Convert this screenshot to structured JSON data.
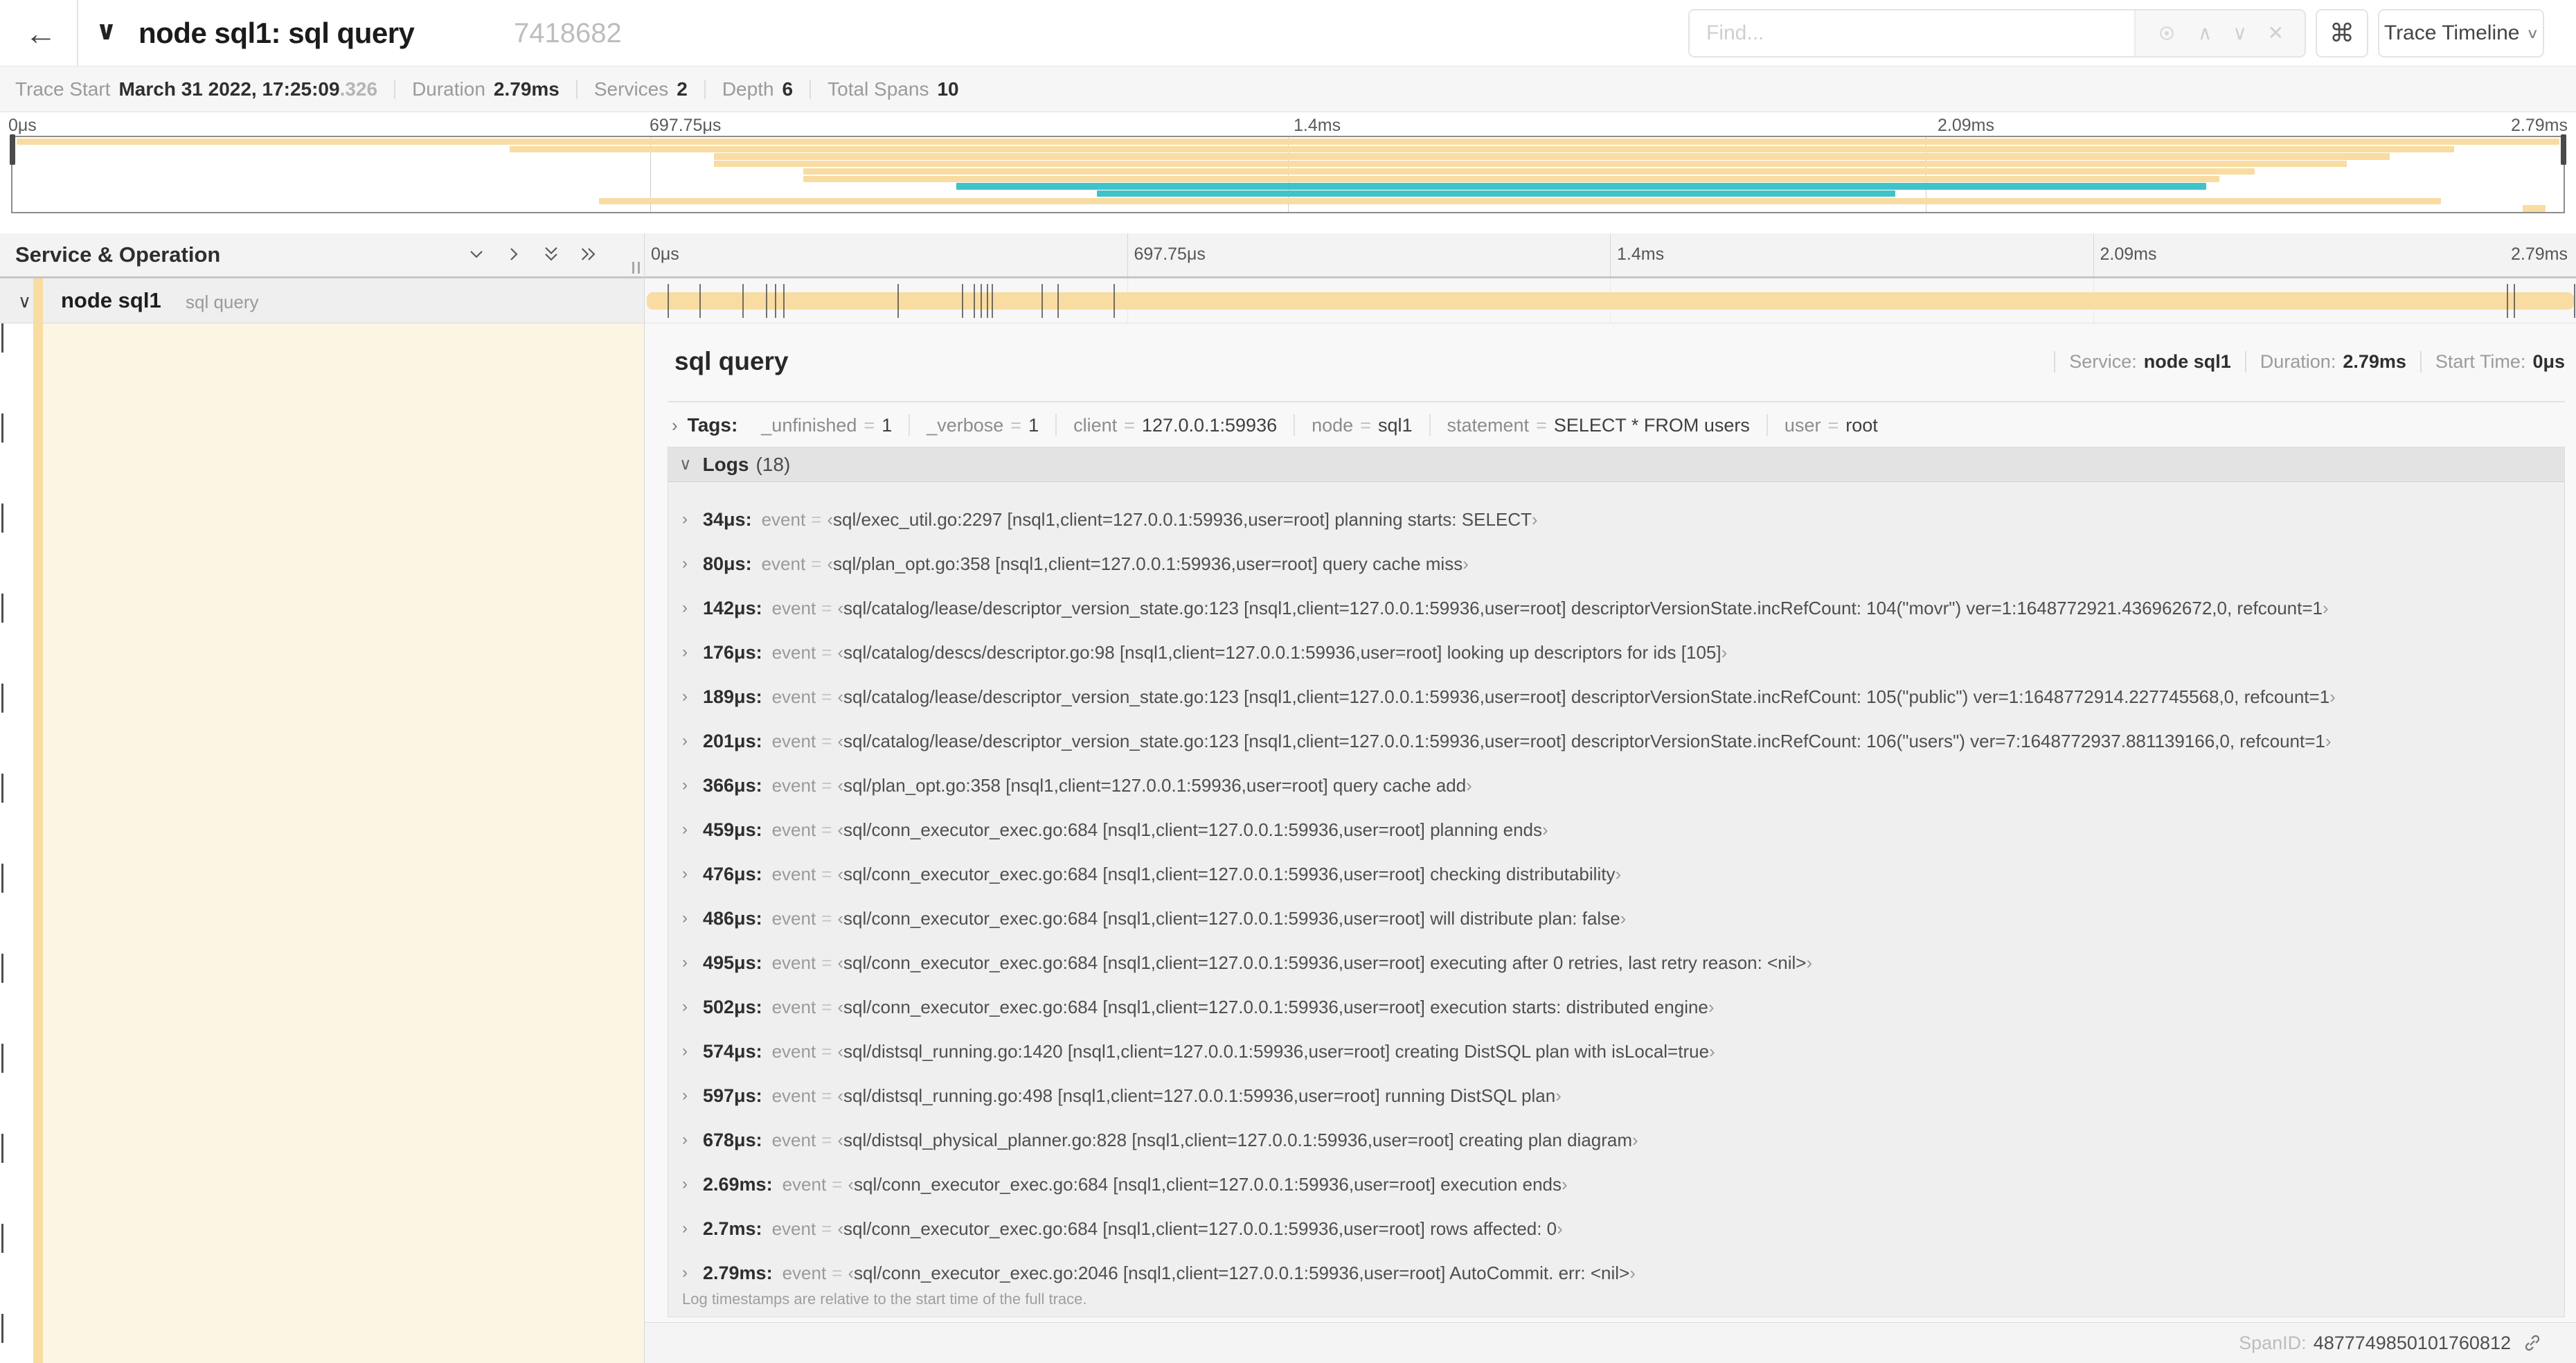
{
  "colors": {
    "span_tan": "#F8DCA1",
    "span_teal": "#3FC3C9",
    "selected_row_bg": "#FCF5E4"
  },
  "glyphs": {
    "back": "←",
    "chev_down": "∨",
    "chev_right": "›",
    "chev_up": "∧",
    "clear": "✕",
    "cmd": "⌘"
  },
  "header": {
    "title": "node sql1: sql query",
    "trace_id": "7418682",
    "find_placeholder": "Find...",
    "view_button": "Trace Timeline"
  },
  "meta": {
    "items": [
      {
        "label": "Trace Start",
        "value": "March 31 2022, 17:25:09",
        "suffix": ".326"
      },
      {
        "label": "Duration",
        "value": "2.79ms",
        "suffix": ""
      },
      {
        "label": "Services",
        "value": "2",
        "suffix": ""
      },
      {
        "label": "Depth",
        "value": "6",
        "suffix": ""
      },
      {
        "label": "Total Spans",
        "value": "10",
        "suffix": ""
      }
    ]
  },
  "ruler": {
    "ticks": [
      "0μs",
      "697.75μs",
      "1.4ms",
      "2.09ms",
      "2.79ms"
    ]
  },
  "minimap": {
    "spans": [
      {
        "s": 0.15,
        "e": 99.85,
        "c": "tan"
      },
      {
        "s": 19.5,
        "e": 95.7,
        "c": "tan"
      },
      {
        "s": 27.5,
        "e": 93.2,
        "c": "tan"
      },
      {
        "s": 27.5,
        "e": 91.5,
        "c": "tan"
      },
      {
        "s": 31.0,
        "e": 87.9,
        "c": "tan"
      },
      {
        "s": 31.0,
        "e": 86.5,
        "c": "tan"
      },
      {
        "s": 37.0,
        "e": 86.0,
        "c": "teal"
      },
      {
        "s": 42.5,
        "e": 73.8,
        "c": "teal"
      },
      {
        "s": 23.0,
        "e": 95.2,
        "c": "tan"
      },
      {
        "s": 98.4,
        "e": 99.3,
        "c": "tan"
      }
    ]
  },
  "timeline": {
    "left_title": "Service & Operation",
    "ticks": [
      "0μs",
      "697.75μs",
      "1.4ms",
      "2.09ms",
      "2.79ms"
    ]
  },
  "row": {
    "service": "node sql1",
    "operation": "sql query",
    "log_ticks_pct": [
      1.22,
      2.87,
      5.09,
      6.31,
      6.77,
      7.2,
      13.12,
      16.45,
      17.06,
      17.42,
      17.74,
      17.99,
      20.57,
      21.4,
      24.3,
      96.42,
      96.77,
      99.9
    ]
  },
  "detail": {
    "title": "sql query",
    "stats": [
      {
        "label": "Service:",
        "value": "node sql1"
      },
      {
        "label": "Duration:",
        "value": "2.79ms"
      },
      {
        "label": "Start Time:",
        "value": "0μs"
      }
    ],
    "tags": {
      "label": "Tags:",
      "eq": "=",
      "items": [
        {
          "key": "_unfinished",
          "value": "1"
        },
        {
          "key": "_verbose",
          "value": "1"
        },
        {
          "key": "client",
          "value": "127.0.0.1:59936"
        },
        {
          "key": "node",
          "value": "sql1"
        },
        {
          "key": "statement",
          "value": "SELECT * FROM users"
        },
        {
          "key": "user",
          "value": "root"
        }
      ]
    },
    "logs": {
      "label": "Logs",
      "count": "(18)",
      "field": "event",
      "eq": "=",
      "quote_open": "‹",
      "quote_close": "›",
      "entries": [
        {
          "t": "34μs:",
          "msg": "sql/exec_util.go:2297 [nsql1,client=127.0.0.1:59936,user=root] planning starts: SELECT"
        },
        {
          "t": "80μs:",
          "msg": "sql/plan_opt.go:358 [nsql1,client=127.0.0.1:59936,user=root] query cache miss"
        },
        {
          "t": "142μs:",
          "msg": "sql/catalog/lease/descriptor_version_state.go:123 [nsql1,client=127.0.0.1:59936,user=root] descriptorVersionState.incRefCount: 104(\"movr\") ver=1:1648772921.436962672,0, refcount=1"
        },
        {
          "t": "176μs:",
          "msg": "sql/catalog/descs/descriptor.go:98 [nsql1,client=127.0.0.1:59936,user=root] looking up descriptors for ids [105]"
        },
        {
          "t": "189μs:",
          "msg": "sql/catalog/lease/descriptor_version_state.go:123 [nsql1,client=127.0.0.1:59936,user=root] descriptorVersionState.incRefCount: 105(\"public\") ver=1:1648772914.227745568,0, refcount=1"
        },
        {
          "t": "201μs:",
          "msg": "sql/catalog/lease/descriptor_version_state.go:123 [nsql1,client=127.0.0.1:59936,user=root] descriptorVersionState.incRefCount: 106(\"users\") ver=7:1648772937.881139166,0, refcount=1"
        },
        {
          "t": "366μs:",
          "msg": "sql/plan_opt.go:358 [nsql1,client=127.0.0.1:59936,user=root] query cache add"
        },
        {
          "t": "459μs:",
          "msg": "sql/conn_executor_exec.go:684 [nsql1,client=127.0.0.1:59936,user=root] planning ends"
        },
        {
          "t": "476μs:",
          "msg": "sql/conn_executor_exec.go:684 [nsql1,client=127.0.0.1:59936,user=root] checking distributability"
        },
        {
          "t": "486μs:",
          "msg": "sql/conn_executor_exec.go:684 [nsql1,client=127.0.0.1:59936,user=root] will distribute plan: false"
        },
        {
          "t": "495μs:",
          "msg": "sql/conn_executor_exec.go:684 [nsql1,client=127.0.0.1:59936,user=root] executing after 0 retries, last retry reason: <nil>"
        },
        {
          "t": "502μs:",
          "msg": "sql/conn_executor_exec.go:684 [nsql1,client=127.0.0.1:59936,user=root] execution starts: distributed engine"
        },
        {
          "t": "574μs:",
          "msg": "sql/distsql_running.go:1420 [nsql1,client=127.0.0.1:59936,user=root] creating DistSQL plan with isLocal=true"
        },
        {
          "t": "597μs:",
          "msg": "sql/distsql_running.go:498 [nsql1,client=127.0.0.1:59936,user=root] running DistSQL plan"
        },
        {
          "t": "678μs:",
          "msg": "sql/distsql_physical_planner.go:828 [nsql1,client=127.0.0.1:59936,user=root] creating plan diagram"
        },
        {
          "t": "2.69ms:",
          "msg": "sql/conn_executor_exec.go:684 [nsql1,client=127.0.0.1:59936,user=root] execution ends"
        },
        {
          "t": "2.7ms:",
          "msg": "sql/conn_executor_exec.go:684 [nsql1,client=127.0.0.1:59936,user=root] rows affected: 0"
        },
        {
          "t": "2.79ms:",
          "msg": "sql/conn_executor_exec.go:2046 [nsql1,client=127.0.0.1:59936,user=root] AutoCommit. err: <nil>"
        }
      ],
      "note": "Log timestamps are relative to the start time of the full trace."
    },
    "footer": {
      "label": "SpanID:",
      "value": "4877749850101760812"
    }
  }
}
